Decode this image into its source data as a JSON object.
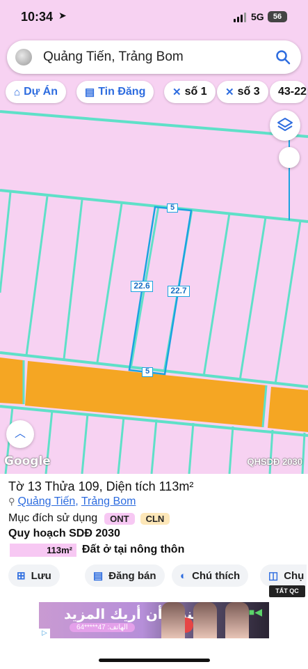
{
  "status_bar": {
    "time": "10:34",
    "network": "5G",
    "battery": "56"
  },
  "search": {
    "query": "Quảng Tiến, Trảng Bom"
  },
  "chips": [
    {
      "icon": "project-icon",
      "label": "Dự Án",
      "style": "blue"
    },
    {
      "icon": "listing-icon",
      "label": "Tin Đăng",
      "style": "blue"
    },
    {
      "icon": "close-x-icon",
      "label": "số 1",
      "style": "plain"
    },
    {
      "icon": "close-x-icon",
      "label": "số 3",
      "style": "plain"
    },
    {
      "icon": "",
      "label": "43-22",
      "style": "plain"
    }
  ],
  "map": {
    "land_color": "#f7d2f2",
    "road_color": "#f5a623",
    "boundary_color": "#5fe0c8",
    "selected_outline": "#1aa3e0",
    "dimension_labels": [
      "5",
      "22.6",
      "22.7",
      "5"
    ],
    "attribution": "Google",
    "layer_name": "QHSDĐ 2030"
  },
  "parcel": {
    "title": "Tờ 13 Thửa 109, Diện tích 113m²",
    "ward": "Quảng Tiến",
    "separator": ", ",
    "district": "Trảng Bom",
    "purpose_label": "Mục đích sử dụng",
    "purpose_tags": [
      "ONT",
      "CLN"
    ],
    "plan_title": "Quy hoạch SDĐ 2030",
    "plan_area": "113m²",
    "plan_description": "Đất ở tại nông thôn"
  },
  "actions": [
    {
      "icon": "save-icon",
      "label": "Lưu"
    },
    {
      "icon": "post-listing-icon",
      "label": "Đăng bán"
    },
    {
      "icon": "legend-icon",
      "label": "Chú thích"
    },
    {
      "icon": "camera-icon",
      "label": "Chụ"
    }
  ],
  "hide_all_label": "TẤT QC",
  "ad": {
    "headline": "يمكنني أن أريك المزيد",
    "phone": "64*****47 :الهاتف"
  }
}
